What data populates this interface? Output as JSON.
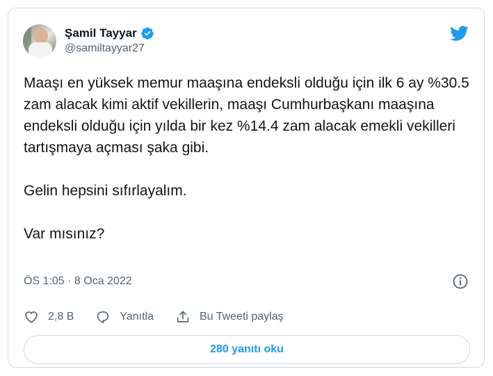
{
  "author": {
    "name": "Şamil Tayyar",
    "handle": "@samiltayyar27",
    "verified": true
  },
  "tweet": {
    "text": "Maaşı en yüksek memur maaşına endeksli olduğu için ilk 6 ay %30.5 zam alacak kimi aktif vekillerin, maaşı Cumhurbaşkanı maaşına endeksli olduğu için yılda bir kez %14.4 zam alacak emekli vekilleri tartışmaya açması şaka gibi.\n\nGelin hepsini sıfırlayalım.\n\nVar mısınız?",
    "timestamp": "ÖS 1:05 · 8 Oca 2022"
  },
  "actions": {
    "like_count": "2,8 B",
    "reply_label": "Yanıtla",
    "share_label": "Bu Tweeti paylaş"
  },
  "replies_button": "280 yanıtı oku",
  "colors": {
    "accent": "#1d9bf0",
    "text": "#0f1419",
    "secondary": "#536471",
    "border": "#cfd9de"
  },
  "icons": {
    "brand": "twitter-bird-icon",
    "verified": "verified-badge-icon",
    "info": "info-icon",
    "like": "heart-icon",
    "reply": "speech-bubble-icon",
    "share": "share-upload-icon"
  }
}
